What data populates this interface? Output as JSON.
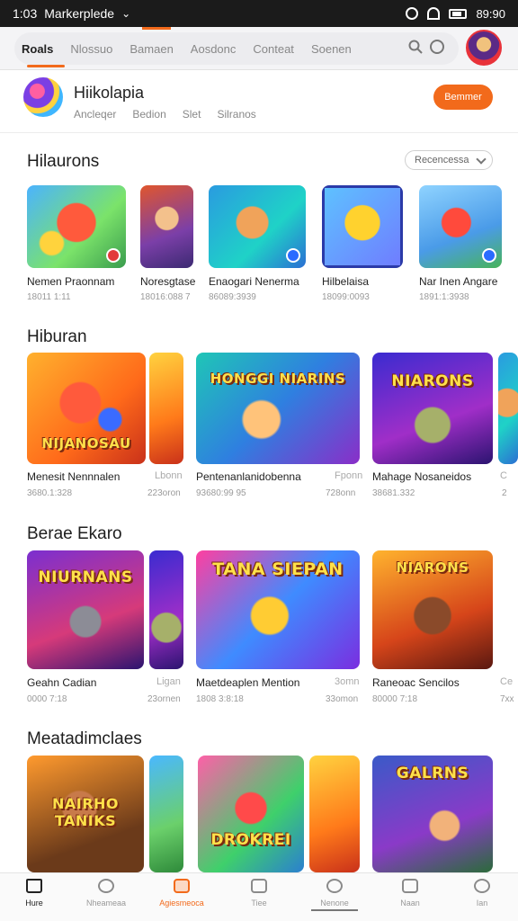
{
  "status_bar": {
    "time": "1:03",
    "app_name": "Markerplede",
    "battery": "89:90"
  },
  "top_nav": {
    "tabs": [
      "Roals",
      "Nlossuo",
      "Bamaen",
      "Aosdonc",
      "Conteat",
      "Soenen"
    ]
  },
  "app_header": {
    "title": "Hiikolapia",
    "subtabs": [
      "Ancleqer",
      "Bedion",
      "Slet",
      "Silranos"
    ],
    "button_label": "Bemmer"
  },
  "section1": {
    "title": "Hilaurons",
    "dropdown_value": "Recencessa",
    "items": [
      {
        "name": "Nemen Praonnam",
        "meta": "18011 1:11"
      },
      {
        "name": "Noresgtase",
        "meta": "18016:088 7"
      },
      {
        "name": "Enaogari Nenerma",
        "meta": "86089:3939"
      },
      {
        "name": "Hilbelaisa",
        "meta": "18099:0093"
      },
      {
        "name": "Nar Inen Angare",
        "meta": "1891:1:3938"
      }
    ]
  },
  "section2": {
    "title": "Hiburan",
    "items": [
      {
        "name": "Menesit Nennnalen",
        "meta": "3680.1:328",
        "side": "Lbonn",
        "side_meta": "223oron",
        "art_text": "NIJANOSAU"
      },
      {
        "name": "Pentenanlanidobenna",
        "meta": "93680:99 95",
        "side": "Fponn",
        "side_meta": "728onn",
        "art_text": "HONGGI NIARINS"
      },
      {
        "name": "Mahage Nosaneidos",
        "meta": "38681.332",
        "side": "C",
        "side_meta": "2",
        "art_text": "NIARONS"
      }
    ]
  },
  "section3": {
    "title": "Berae Ekaro",
    "items": [
      {
        "name": "Geahn Cadian",
        "meta": "0000 7:18",
        "side": "Ligan",
        "side_meta": "23ornen",
        "art_text": "NIURNANS"
      },
      {
        "name": "Maetdeaplen Mention",
        "meta": "1808 3:8:18",
        "side": "3omn",
        "side_meta": "33omon",
        "art_text": "TANA SIEPAN"
      },
      {
        "name": "Raneoac Sencilos",
        "meta": "80000 7:18",
        "side": "Ce",
        "side_meta": "7xx",
        "art_text": "NIARONS"
      }
    ]
  },
  "section4": {
    "title": "Meatadimclaes",
    "items": [
      {
        "art_text": "NAIRHO TANIKS"
      },
      {
        "art_text": "DROKREI"
      },
      {
        "art_text": "GALRNS"
      }
    ]
  },
  "bottom_nav": {
    "items": [
      "Hure",
      "Nheameaa",
      "Agiesmeoca",
      "Tiee",
      "Nenone",
      "Naan",
      "Ian"
    ]
  },
  "colors": {
    "accent": "#f26a1b",
    "status_bar_bg": "#1b1b1b"
  }
}
